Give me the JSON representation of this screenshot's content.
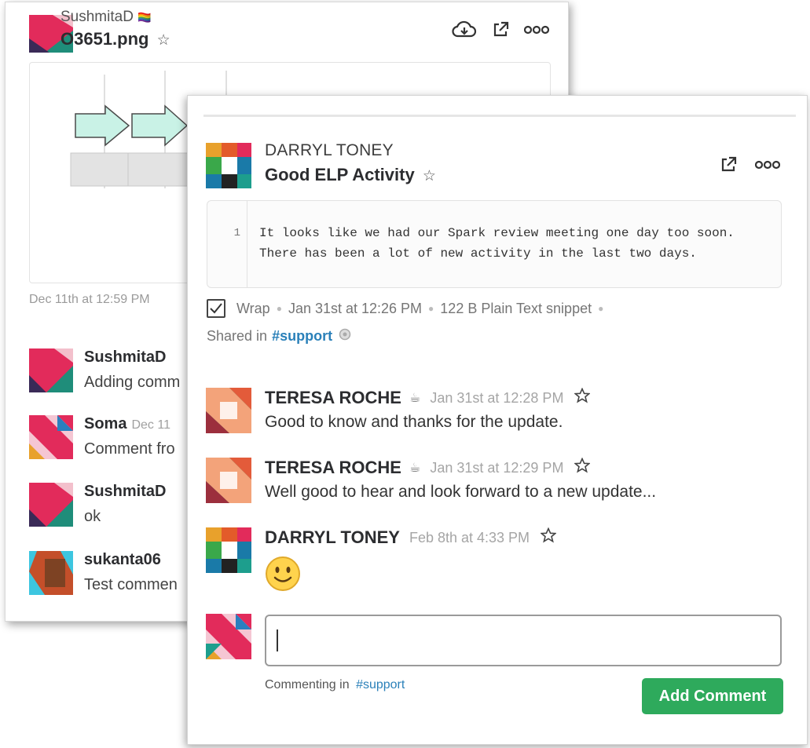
{
  "back_panel": {
    "uploader": "SushmitaD",
    "uploader_badge": "🏳️‍🌈",
    "file_name": "O3651.png",
    "file_star": "☆",
    "preview_timestamp": "Dec 11th at 12:59 PM",
    "comments": [
      {
        "name": "SushmitaD",
        "time": "",
        "text": "Adding comm"
      },
      {
        "name": "Soma",
        "time": "Dec 11",
        "text": "Comment fro"
      },
      {
        "name": "SushmitaD",
        "time": "",
        "text": "ok"
      },
      {
        "name": "sukanta06",
        "time": "",
        "text": "Test commen"
      }
    ]
  },
  "front_panel": {
    "snippet": {
      "author": "DARRYL TONEY",
      "title": "Good ELP Activity",
      "star": "☆",
      "line_number": "1",
      "code_lines": [
        "It looks like we had our Spark review meeting one day too soon.",
        "There has been a lot of new activity in the last two days."
      ],
      "wrap_label": "Wrap",
      "date": "Jan 31st at 12:26 PM",
      "size_type": "122 B Plain Text snippet",
      "shared_prefix": "Shared in",
      "shared_channel": "#support"
    },
    "messages": [
      {
        "name": "TERESA ROCHE",
        "status": "☕",
        "time": "Jan 31st at 12:28 PM",
        "text": "Good to know and thanks for the update."
      },
      {
        "name": "TERESA ROCHE",
        "status": "☕",
        "time": "Jan 31st at 12:29 PM",
        "text": "Well good to hear and look forward to a new update..."
      },
      {
        "name": "DARRYL TONEY",
        "status": "",
        "time": "Feb 8th at 4:33 PM",
        "text": ""
      }
    ],
    "composer": {
      "input_value": "",
      "commenting_prefix": "Commenting in",
      "commenting_channel": "#support",
      "add_comment_label": "Add Comment"
    }
  },
  "colors": {
    "accent_green": "#2eaa5c",
    "link_blue": "#2a80b9"
  },
  "icons": [
    "cloud-download-icon",
    "external-link-icon",
    "more-icon",
    "star-icon",
    "checkbox-icon",
    "info-icon",
    "smile-emoji-icon"
  ]
}
